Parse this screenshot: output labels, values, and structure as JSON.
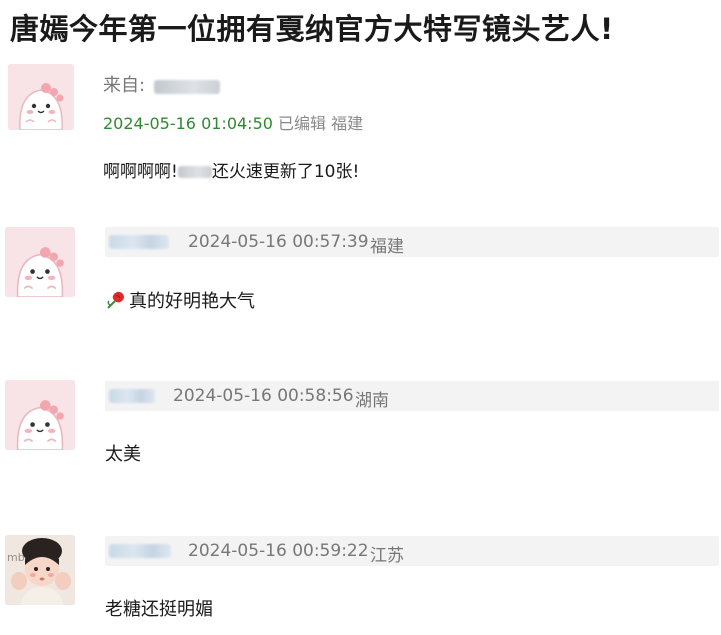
{
  "headline": "唐嫣今年第一位拥有戛纳官方大特写镜头艺人!",
  "post": {
    "from_label": "来自:",
    "timestamp": "2024-05-16 01:04:50",
    "edited": "已编辑",
    "location": "福建",
    "text_before": "啊啊啊啊!",
    "text_after": "还火速更新了10张!"
  },
  "comments": [
    {
      "timestamp": "2024-05-16 00:57:39",
      "location": "福建",
      "text": "真的好明艳大气"
    },
    {
      "timestamp": "2024-05-16 00:58:56",
      "location": "湖南",
      "text": "太美"
    },
    {
      "timestamp": "2024-05-16 00:59:22",
      "location": "江苏",
      "text": "老糖还挺明媚"
    }
  ],
  "colors": {
    "timestamp_green": "#2f8a2f",
    "meta_gray": "#8a8a8a",
    "strip_bg": "#f3f3f3",
    "avatar_pink": "#f7dfe2"
  },
  "icons": [
    "dino-avatar-icon",
    "child-avatar-icon",
    "rose-emoji-icon"
  ]
}
